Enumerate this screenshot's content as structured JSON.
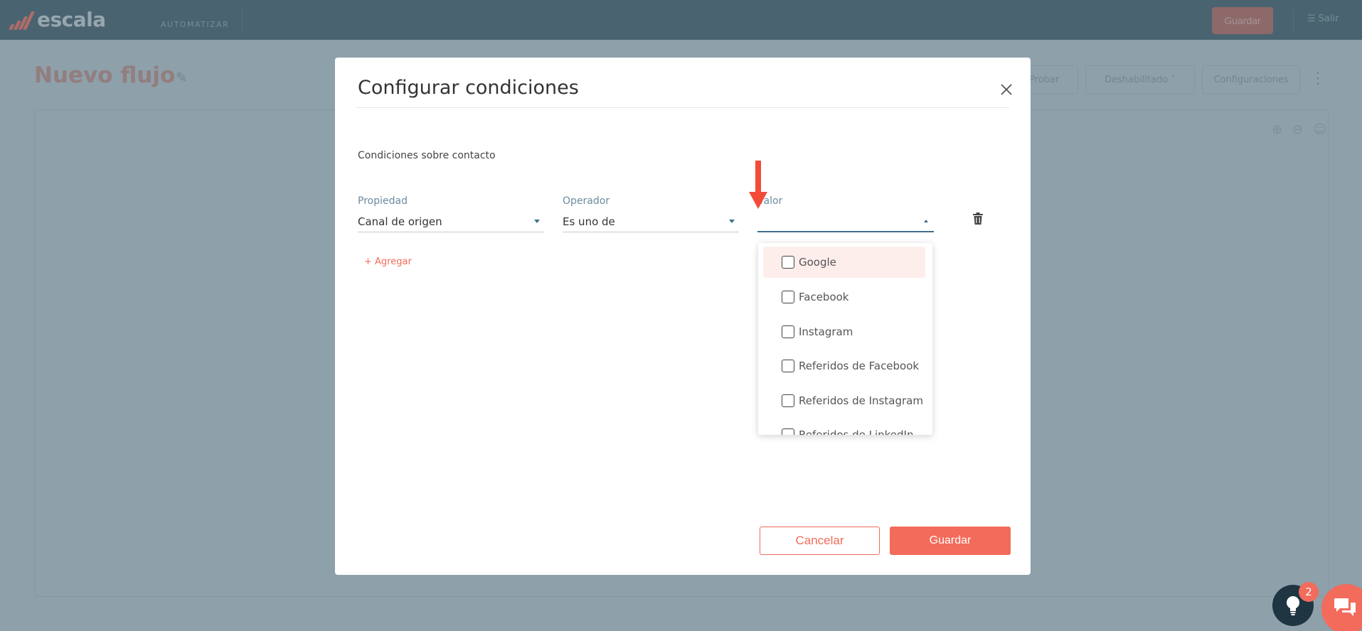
{
  "app": {
    "logo_text": "escala",
    "nav_item": "AUTOMATIZAR",
    "save_label": "Guardar",
    "exit_label": "Salir"
  },
  "page": {
    "title": "Nuevo flujo",
    "actions": [
      "Probar",
      "Deshabilitado",
      "Configuraciones"
    ]
  },
  "modal": {
    "title": "Configurar condiciones",
    "section_label": "Condiciones sobre contacto",
    "fields": {
      "property": {
        "label": "Propiedad",
        "value": "Canal de origen"
      },
      "operator": {
        "label": "Operador",
        "value": "Es uno de"
      },
      "value": {
        "label": "Valor",
        "value": ""
      }
    },
    "add_label": "+ Agregar",
    "dropdown_options": [
      "Google",
      "Facebook",
      "Instagram",
      "Referidos de Facebook",
      "Referidos de Instagram",
      "Referidos de LinkedIn"
    ],
    "cancel_label": "Cancelar",
    "save_label": "Guardar"
  },
  "widgets": {
    "tips_badge_count": "2"
  },
  "colors": {
    "accent": "#f26b5b",
    "topbar": "#3d5a6b",
    "field_label": "#6b8ba0"
  }
}
